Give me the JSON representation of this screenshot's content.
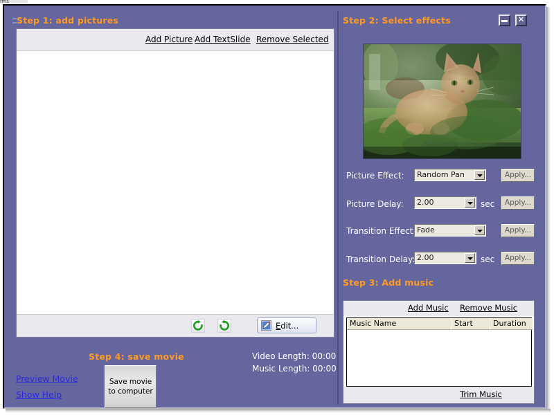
{
  "window": {
    "top_sliver_text": "fms",
    "minimize_label": "–",
    "close_label": "✕"
  },
  "step1": {
    "title": "Step 1: add pictures",
    "toolbar": {
      "add_picture": "Add Picture",
      "add_textslide": "Add TextSlide",
      "remove_selected": "Remove Selected"
    },
    "footer": {
      "rotate_cw_icon": "rotate-clockwise-icon",
      "rotate_ccw_icon": "rotate-counterclockwise-icon",
      "edit_label_pre": "",
      "edit_label_accesskey": "E",
      "edit_label_post": "dit..."
    },
    "list_items": []
  },
  "step2": {
    "title": "Step 2: Select effects",
    "preview_alt": "ginger kitten in garden, semi-transparent blend",
    "rows": [
      {
        "label": "Picture Effect:",
        "value": "Random Pan",
        "unit": "",
        "apply": "Apply..."
      },
      {
        "label": "Picture Delay:",
        "value": "2.00",
        "unit": "sec",
        "apply": "Apply..."
      },
      {
        "label": "Transition Effect:",
        "value": "Fade",
        "unit": "",
        "apply": "Apply..."
      },
      {
        "label": "Transition Delay:",
        "value": "2.00",
        "unit": "sec",
        "apply": "Apply..."
      }
    ]
  },
  "step3": {
    "title": "Step 3: Add music",
    "add_music": "Add Music",
    "remove_music": "Remove Music",
    "trim_music": "Trim Music",
    "columns": [
      "Music Name",
      "Start",
      "Duration"
    ],
    "rows": []
  },
  "step4": {
    "title": "Step 4: save movie",
    "preview_movie": "Preview Movie",
    "show_help": "Show Help",
    "save_button": "Save movie to computer",
    "video_length": "Video Length: 00:00",
    "music_length": "Music Length: 00:00"
  },
  "colors": {
    "panel_purple": "#66669e",
    "step_title_orange": "#ff9a22",
    "link_blue": "#2a2ae0",
    "toolbar_gray": "#eaeaee",
    "grid_header": "#ece9d8"
  }
}
